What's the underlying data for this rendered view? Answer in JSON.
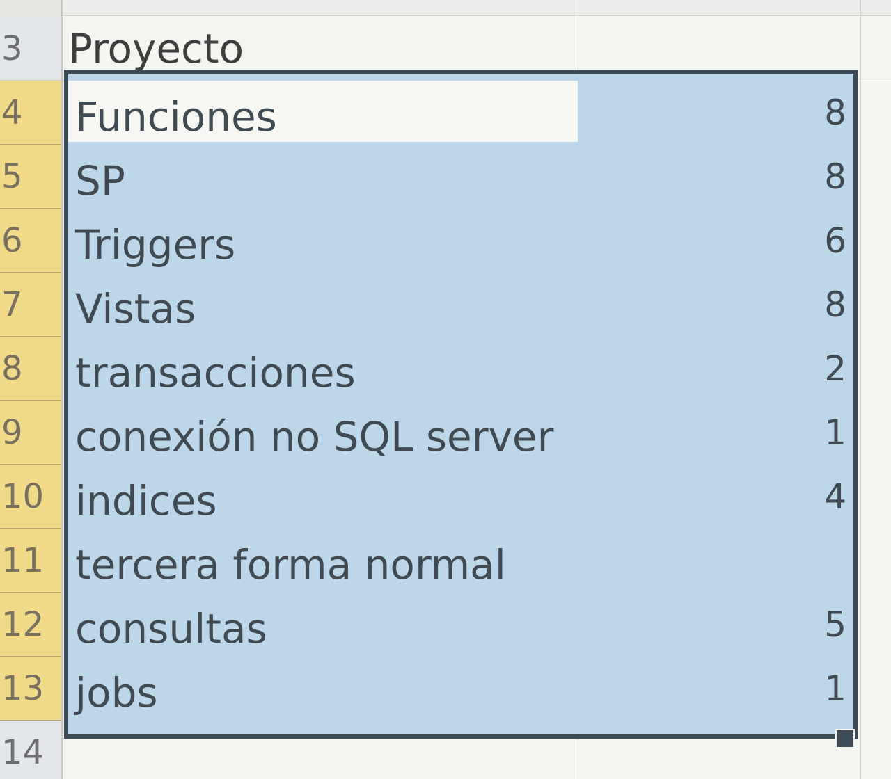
{
  "colors": {
    "selection_fill": "#bcd6ea",
    "selection_border": "#3c4a55",
    "row_header_selected": "#f1d98a",
    "row_header_default": "#e3e6ea"
  },
  "header": {
    "row_number": "3",
    "label": "Proyecto"
  },
  "rows": [
    {
      "row_number": "4",
      "label": "Funciones",
      "value": "8"
    },
    {
      "row_number": "5",
      "label": "SP",
      "value": "8"
    },
    {
      "row_number": "6",
      "label": "Triggers",
      "value": "6"
    },
    {
      "row_number": "7",
      "label": "Vistas",
      "value": "8"
    },
    {
      "row_number": "8",
      "label": "transacciones",
      "value": "2"
    },
    {
      "row_number": "9",
      "label": "conexión no SQL server",
      "value": "1"
    },
    {
      "row_number": "10",
      "label": "indices",
      "value": "4"
    },
    {
      "row_number": "11",
      "label": "tercera forma normal",
      "value": ""
    },
    {
      "row_number": "12",
      "label": "consultas",
      "value": "5"
    },
    {
      "row_number": "13",
      "label": "jobs",
      "value": "1"
    }
  ],
  "after_row_number": "14"
}
